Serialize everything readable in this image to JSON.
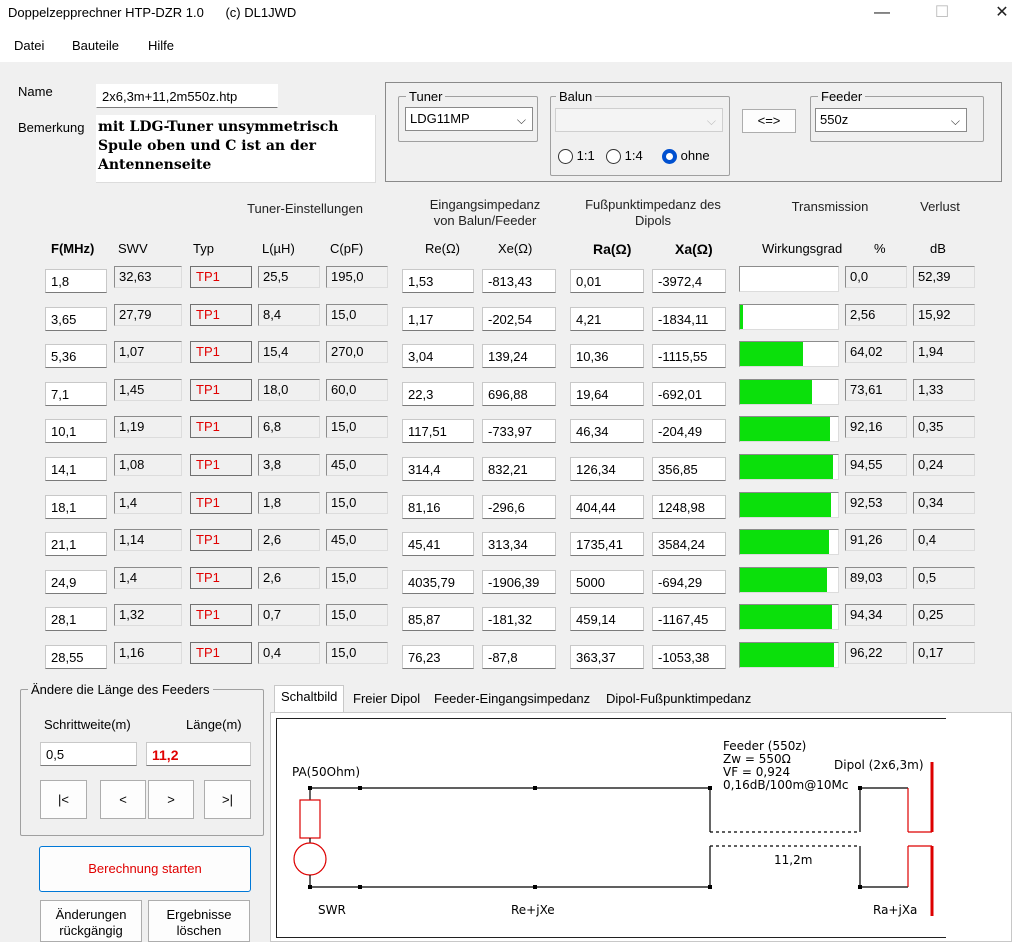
{
  "window": {
    "title": "Doppelzepprechner HTP-DZR 1.0      (c) DL1JWD",
    "minimize": "—",
    "maximize": "☐",
    "close": "✕"
  },
  "menu": [
    "Datei",
    "Bauteile",
    "Hilfe"
  ],
  "form": {
    "name_label": "Name",
    "name_value": "2x6,3m+11,2m550z.htp",
    "remark_label": "Bemerkung",
    "remark_lines": [
      "mit LDG-Tuner unsymmetrisch",
      "Spule oben und C ist an der",
      "Antennenseite"
    ]
  },
  "tuner": {
    "group": "Tuner",
    "value": "LDG11MP"
  },
  "balun": {
    "group": "Balun",
    "value": "",
    "options": [
      "1:1",
      "1:4",
      "ohne"
    ],
    "selected": "ohne"
  },
  "swap_button": "<=>",
  "feeder": {
    "group": "Feeder",
    "value": "550z"
  },
  "headers": {
    "tuner_settings": "Tuner-Einstellungen",
    "input_imp_1": "Eingangsimpedanz",
    "input_imp_2": "von Balun/Feeder",
    "foot_imp_1": "Fußpunktimpedanz des",
    "foot_imp_2": "Dipols",
    "transmission": "Transmission",
    "loss": "Verlust",
    "f": "F(MHz)",
    "swv": "SWV",
    "typ": "Typ",
    "l": "L(µH)",
    "c": "C(pF)",
    "re": "Re(Ω)",
    "xe": "Xe(Ω)",
    "ra": "Ra(Ω)",
    "xa": "Xa(Ω)",
    "eff": "Wirkungsgrad",
    "pct": "%",
    "db": "dB"
  },
  "rows": [
    {
      "f": "1,8",
      "swv": "32,63",
      "typ": "TP1",
      "l": "25,5",
      "c": "195,0",
      "re": "1,53",
      "xe": "-813,43",
      "ra": "0,01",
      "xa": "-3972,4",
      "pct": "0,0",
      "db": "52,39",
      "eff": 0.0
    },
    {
      "f": "3,65",
      "swv": "27,79",
      "typ": "TP1",
      "l": "8,4",
      "c": "15,0",
      "re": "1,17",
      "xe": "-202,54",
      "ra": "4,21",
      "xa": "-1834,11",
      "pct": "2,56",
      "db": "15,92",
      "eff": 2.56
    },
    {
      "f": "5,36",
      "swv": "1,07",
      "typ": "TP1",
      "l": "15,4",
      "c": "270,0",
      "re": "3,04",
      "xe": "139,24",
      "ra": "10,36",
      "xa": "-1115,55",
      "pct": "64,02",
      "db": "1,94",
      "eff": 64.02
    },
    {
      "f": "7,1",
      "swv": "1,45",
      "typ": "TP1",
      "l": "18,0",
      "c": "60,0",
      "re": "22,3",
      "xe": "696,88",
      "ra": "19,64",
      "xa": "-692,01",
      "pct": "73,61",
      "db": "1,33",
      "eff": 73.61
    },
    {
      "f": "10,1",
      "swv": "1,19",
      "typ": "TP1",
      "l": "6,8",
      "c": "15,0",
      "re": "117,51",
      "xe": "-733,97",
      "ra": "46,34",
      "xa": "-204,49",
      "pct": "92,16",
      "db": "0,35",
      "eff": 92.16
    },
    {
      "f": "14,1",
      "swv": "1,08",
      "typ": "TP1",
      "l": "3,8",
      "c": "45,0",
      "re": "314,4",
      "xe": "832,21",
      "ra": "126,34",
      "xa": "356,85",
      "pct": "94,55",
      "db": "0,24",
      "eff": 94.55
    },
    {
      "f": "18,1",
      "swv": "1,4",
      "typ": "TP1",
      "l": "1,8",
      "c": "15,0",
      "re": "81,16",
      "xe": "-296,6",
      "ra": "404,44",
      "xa": "1248,98",
      "pct": "92,53",
      "db": "0,34",
      "eff": 92.53
    },
    {
      "f": "21,1",
      "swv": "1,14",
      "typ": "TP1",
      "l": "2,6",
      "c": "45,0",
      "re": "45,41",
      "xe": "313,34",
      "ra": "1735,41",
      "xa": "3584,24",
      "pct": "91,26",
      "db": "0,4",
      "eff": 91.26
    },
    {
      "f": "24,9",
      "swv": "1,4",
      "typ": "TP1",
      "l": "2,6",
      "c": "15,0",
      "re": "4035,79",
      "xe": "-1906,39",
      "ra": "5000",
      "xa": "-694,29",
      "pct": "89,03",
      "db": "0,5",
      "eff": 89.03
    },
    {
      "f": "28,1",
      "swv": "1,32",
      "typ": "TP1",
      "l": "0,7",
      "c": "15,0",
      "re": "85,87",
      "xe": "-181,32",
      "ra": "459,14",
      "xa": "-1167,45",
      "pct": "94,34",
      "db": "0,25",
      "eff": 94.34
    },
    {
      "f": "28,55",
      "swv": "1,16",
      "typ": "TP1",
      "l": "0,4",
      "c": "15,0",
      "re": "76,23",
      "xe": "-87,8",
      "ra": "363,37",
      "xa": "-1053,38",
      "pct": "96,22",
      "db": "0,17",
      "eff": 96.22
    }
  ],
  "feeder_length": {
    "group": "Ändere die Länge des Feeders",
    "step_label": "Schrittweite(m)",
    "length_label": "Länge(m)",
    "step_value": "0,5",
    "length_value": "11,2",
    "btn_first": "|<",
    "btn_prev": "<",
    "btn_next": ">",
    "btn_last": ">|"
  },
  "buttons": {
    "calc": "Berechnung starten",
    "undo_1": "Änderungen",
    "undo_2": "rückgängig",
    "clear_1": "Ergebnisse",
    "clear_2": "löschen"
  },
  "tabs": [
    "Schaltbild",
    "Freier Dipol",
    "Feeder-Eingangsimpedanz",
    "Dipol-Fußpunktimpedanz"
  ],
  "schematic": {
    "pa": "PA(50Ohm)",
    "feeder_1": "Feeder (550z)",
    "feeder_2": "Zw = 550Ω",
    "feeder_3": "VF = 0,924",
    "feeder_4": "0,16dB/100m@10Mc",
    "dipol": "Dipol (2x6,3m)",
    "length": "11,2m",
    "swr": "SWR",
    "rejxe": "Re+jXe",
    "rajxa": "Ra+jXa"
  },
  "colors": {
    "bar": "#0be00b",
    "typ_text": "#e00000",
    "dipole": "#e00000",
    "calc_text": "#e00000"
  }
}
